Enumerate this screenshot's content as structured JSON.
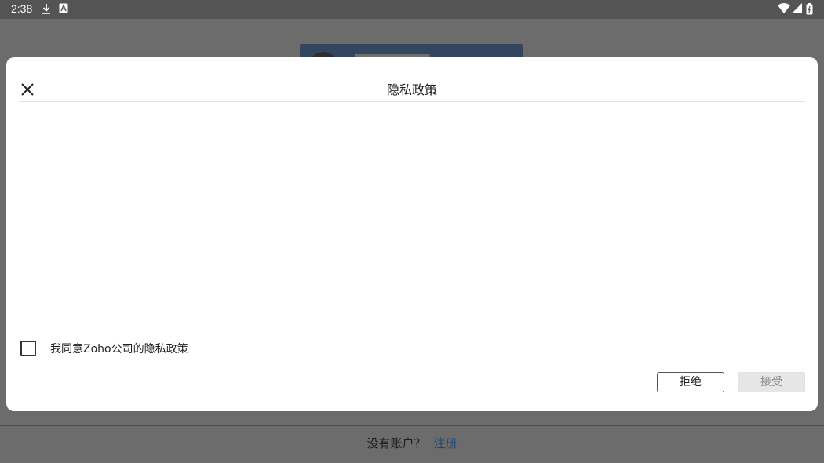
{
  "status_bar": {
    "time": "2:38",
    "left_icons": [
      "download-icon",
      "app-a-icon"
    ],
    "right_icons": [
      "wifi-icon",
      "signal-icon",
      "battery-icon"
    ]
  },
  "background": {
    "footer_prompt": "没有账户？",
    "signup_link": "注册"
  },
  "dialog": {
    "title": "隐私政策",
    "close_icon": "close-icon",
    "agree_checkbox_checked": false,
    "agree_label": "我同意Zoho公司的隐私政策",
    "reject_label": "拒绝",
    "accept_label": "接受",
    "accept_enabled": false
  },
  "colors": {
    "dialog_bg": "#ffffff",
    "scrim": "#6c6c6c",
    "link": "#1c4a75",
    "disabled_button_bg": "#e6e6e6"
  }
}
